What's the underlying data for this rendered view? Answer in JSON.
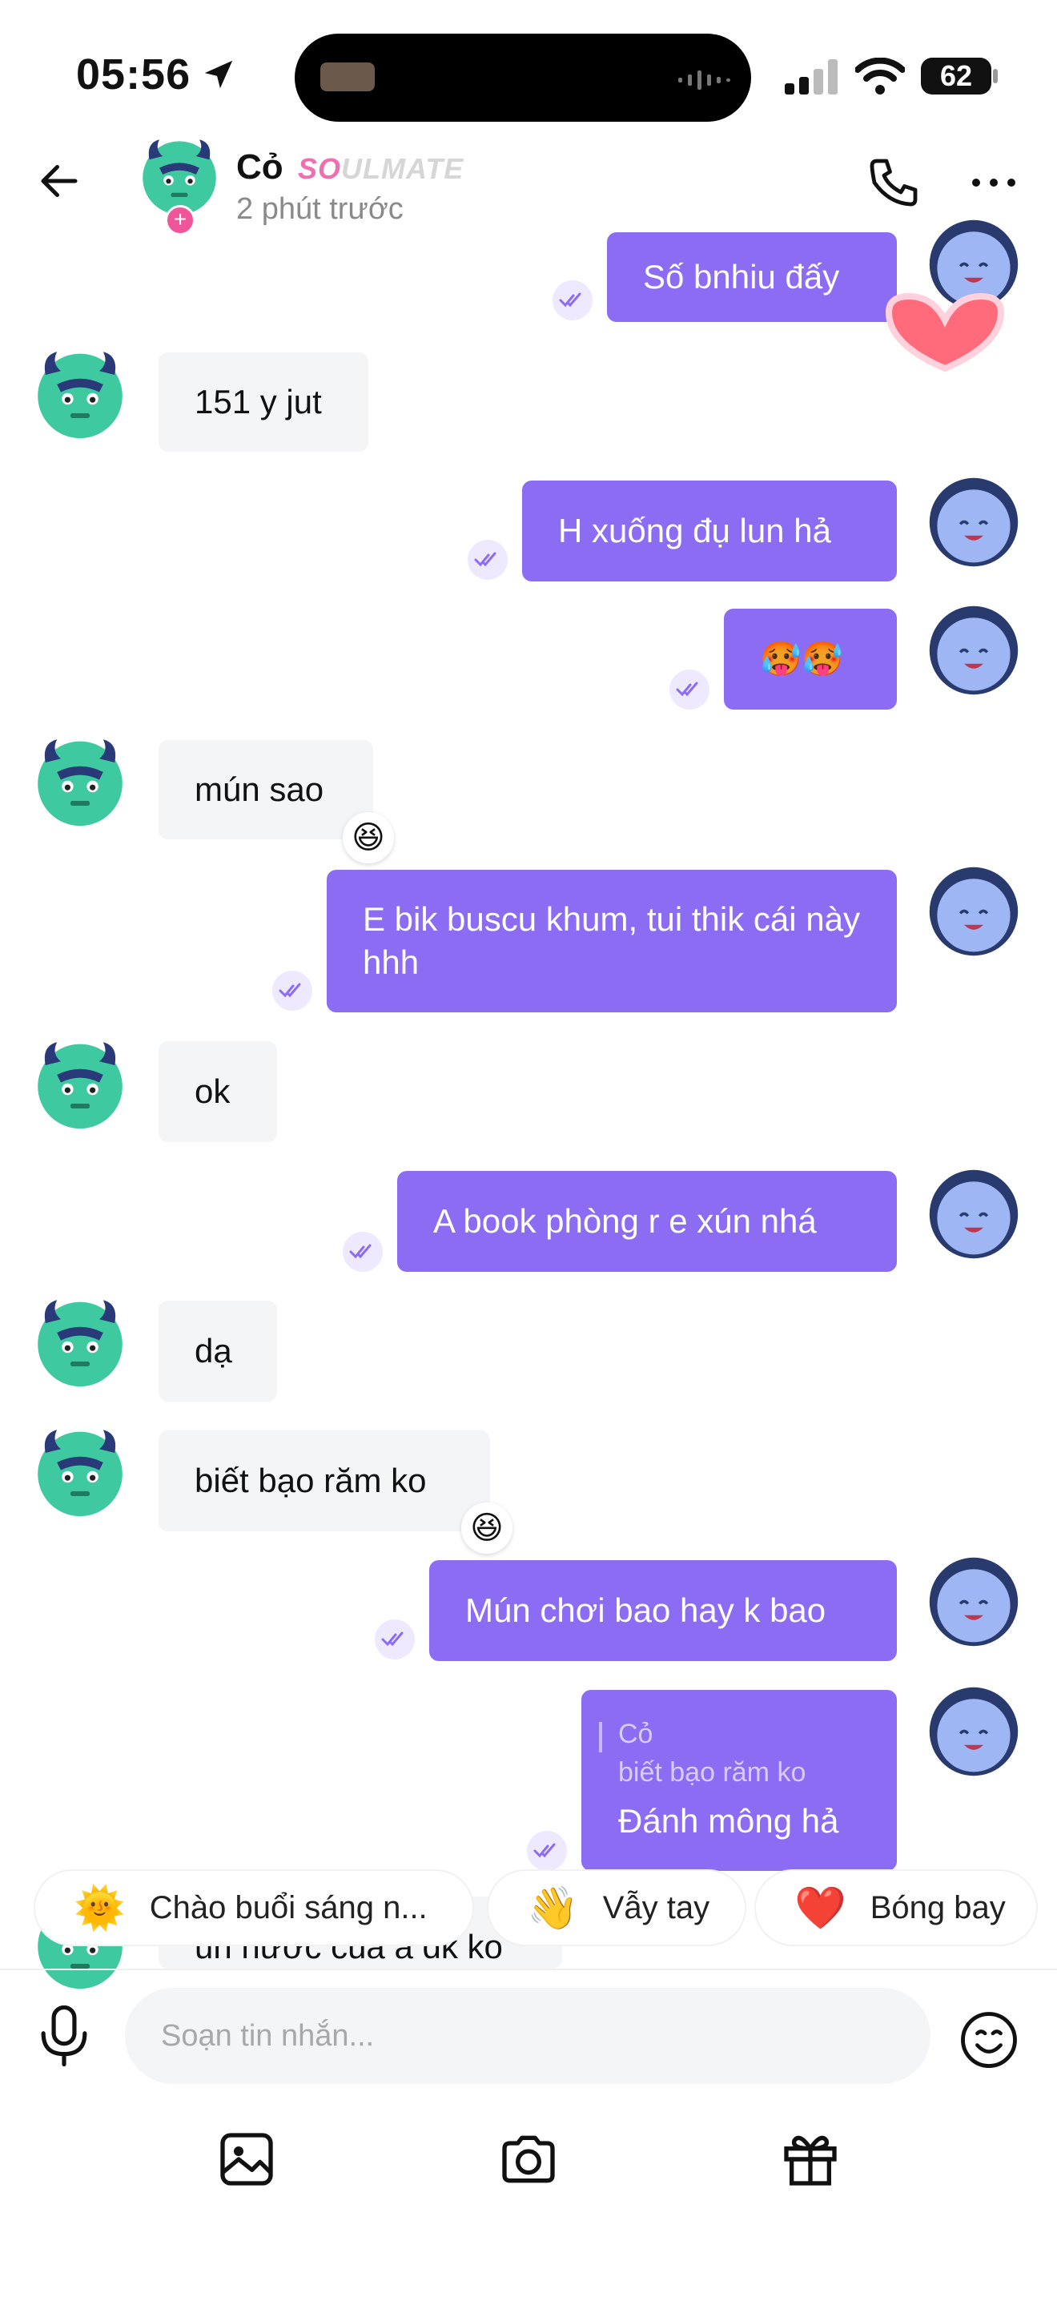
{
  "status_bar": {
    "time": "05:56",
    "battery": "62"
  },
  "header": {
    "name": "Cỏ",
    "badge_prefix": "SO",
    "badge_suffix": "ULMATE",
    "status": "2 phút trước"
  },
  "messages": [
    {
      "id": "m1",
      "from": "me",
      "text": "Số bnhiu đấy"
    },
    {
      "id": "m2",
      "from": "them",
      "text": "151 y jut"
    },
    {
      "id": "m3",
      "from": "me",
      "text": "H xuống đụ lun hả"
    },
    {
      "id": "m4",
      "from": "me",
      "text": "🥵🥵"
    },
    {
      "id": "m5",
      "from": "them",
      "text": "mún sao",
      "reaction": "😆"
    },
    {
      "id": "m6",
      "from": "me",
      "text": "E bik buscu khum, tui thik cái này hhh"
    },
    {
      "id": "m7",
      "from": "them",
      "text": "ok"
    },
    {
      "id": "m8",
      "from": "me",
      "text": "A book phòng r e xún nhá"
    },
    {
      "id": "m9",
      "from": "them",
      "text": "dạ"
    },
    {
      "id": "m10",
      "from": "them",
      "text": "biết bạo răm ko",
      "reaction": "😆"
    },
    {
      "id": "m11",
      "from": "me",
      "text": "Mún chơi bao hay k bao"
    },
    {
      "id": "m12",
      "from": "me",
      "text": "Đánh mông hả",
      "reply_to": {
        "name": "Cỏ",
        "text": "biết bạo răm ko"
      }
    },
    {
      "id": "m13",
      "from": "them",
      "text": "un nươc cua a dk ko"
    }
  ],
  "quick_replies": [
    {
      "emoji": "🌞",
      "label": "Chào buổi sáng n..."
    },
    {
      "emoji": "👋",
      "label": "Vẫy tay"
    },
    {
      "emoji": "❤️",
      "label": "Bóng bay"
    }
  ],
  "composer": {
    "placeholder": "Soạn tin nhắn..."
  },
  "colors": {
    "accent": "#8c6cf2",
    "incoming_bg": "#f4f5f7",
    "badge_pink": "#ef6fb0"
  }
}
